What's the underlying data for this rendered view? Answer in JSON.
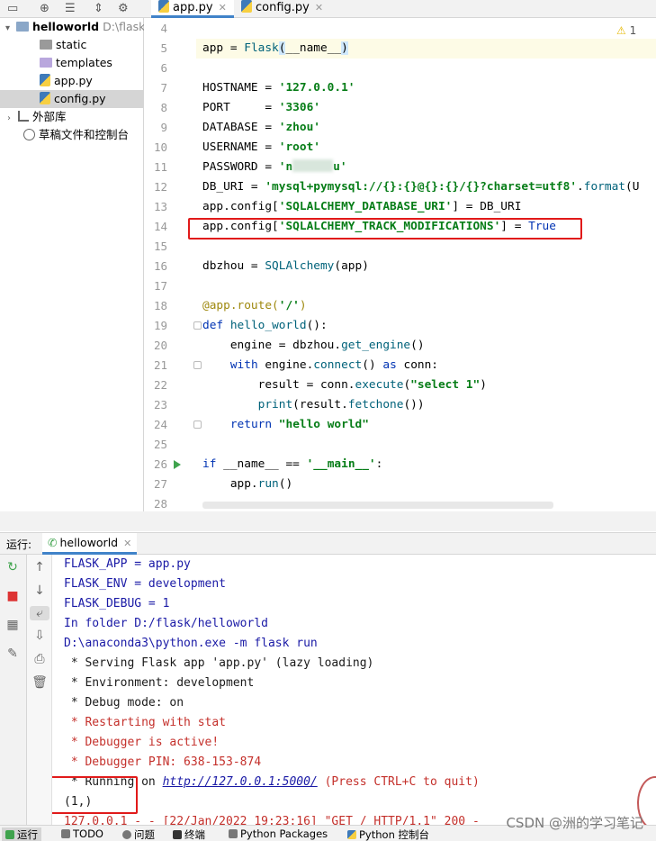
{
  "project_tree": {
    "root": {
      "name": "helloworld",
      "path": "D:\\flask"
    },
    "items": [
      "static",
      "templates",
      "app.py",
      "config.py"
    ],
    "external": "外部库",
    "scratches": "草稿文件和控制台"
  },
  "tabs": [
    "app.py",
    "config.py"
  ],
  "editor": {
    "warning_count": "1",
    "line_numbers": [
      "4",
      "5",
      "6",
      "7",
      "8",
      "9",
      "10",
      "11",
      "12",
      "13",
      "14",
      "15",
      "16",
      "17",
      "18",
      "19",
      "20",
      "21",
      "22",
      "23",
      "24",
      "25",
      "26",
      "27",
      "28"
    ]
  },
  "run_panel": {
    "label": "运行:",
    "tab": "helloworld"
  },
  "console": {
    "lines": [
      {
        "text": "FLASK_APP = app.py",
        "style": "blue"
      },
      {
        "text": "FLASK_ENV = development",
        "style": "blue"
      },
      {
        "text": "FLASK_DEBUG = 1",
        "style": "blue"
      },
      {
        "text": "In folder D:/flask/helloworld",
        "style": "blue"
      },
      {
        "text": "D:\\anaconda3\\python.exe -m flask run",
        "style": "blue"
      },
      {
        "text": " * Serving Flask app 'app.py' (lazy loading)",
        "style": "black"
      },
      {
        "text": " * Environment: development",
        "style": "black"
      },
      {
        "text": " * Debug mode: on",
        "style": "black"
      },
      {
        "text": " * Restarting with stat",
        "style": "red"
      },
      {
        "text": " * Debugger is active!",
        "style": "red"
      },
      {
        "text": " * Debugger PIN: 638-153-874",
        "style": "red"
      }
    ],
    "running_prefix": " * Running on ",
    "running_url": "http://127.0.0.1:5000/",
    "running_suffix": " (Press CTRL+C to quit)",
    "result": "(1,)",
    "access_log": "127.0.0.1 - - [22/Jan/2022 19:23:16] \"GET / HTTP/1.1\" 200 -"
  },
  "statusbar": {
    "items": [
      "运行",
      "TODO",
      "问题",
      "终端",
      "Python Packages",
      "Python 控制台"
    ]
  },
  "watermark": "CSDN @洲的学习笔记"
}
